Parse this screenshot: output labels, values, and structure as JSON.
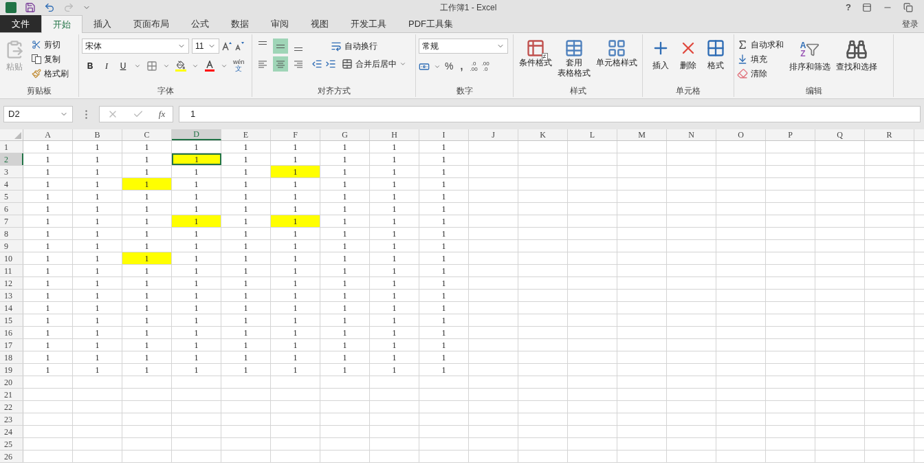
{
  "title_bar": {
    "title": "工作簿1 - Excel",
    "help": "?"
  },
  "ribbon_tabs": {
    "file": "文件",
    "tabs": [
      {
        "label": "开始",
        "selected": true
      },
      {
        "label": "插入",
        "selected": false
      },
      {
        "label": "页面布局",
        "selected": false
      },
      {
        "label": "公式",
        "selected": false
      },
      {
        "label": "数据",
        "selected": false
      },
      {
        "label": "审阅",
        "selected": false
      },
      {
        "label": "视图",
        "selected": false
      },
      {
        "label": "开发工具",
        "selected": false
      },
      {
        "label": "PDF工具集",
        "selected": false
      }
    ],
    "sign_in": "登录"
  },
  "ribbon": {
    "clipboard": {
      "label": "剪贴板",
      "paste": "粘贴",
      "cut": "剪切",
      "copy": "复制",
      "format_painter": "格式刷"
    },
    "font": {
      "label": "字体",
      "font_name": "宋体",
      "font_size": "11",
      "bold": "B",
      "italic": "I",
      "underline": "U",
      "phonetic_top": "wén",
      "phonetic_bottom": "文"
    },
    "alignment": {
      "label": "对齐方式",
      "wrap_text": "自动换行",
      "merge_center": "合并后居中",
      "vertical": [
        {
          "selected": false
        },
        {
          "selected": true
        },
        {
          "selected": false
        }
      ],
      "horizontal": [
        {
          "selected": false
        },
        {
          "selected": true
        },
        {
          "selected": false
        }
      ]
    },
    "number": {
      "label": "数字",
      "format": "常规",
      "percent": "%",
      "comma": ",",
      "decimals": [
        {
          "top": ".0",
          "bottom": ".00"
        },
        {
          "top": ".00",
          "bottom": ".0"
        }
      ]
    },
    "styles": {
      "label": "样式",
      "buttons": [
        {
          "kind": "conditional",
          "lines": [
            "条件格式"
          ],
          "symbol": "≠"
        },
        {
          "kind": "table",
          "lines": [
            "套用",
            "表格格式"
          ]
        },
        {
          "kind": "cell",
          "lines": [
            "单元格样式"
          ]
        }
      ]
    },
    "cells": {
      "label": "单元格",
      "buttons": [
        {
          "kind": "insert",
          "label": "插入"
        },
        {
          "kind": "delete",
          "label": "删除"
        },
        {
          "kind": "format",
          "label": "格式"
        }
      ]
    },
    "editing": {
      "label": "编辑",
      "autosum": "自动求和",
      "fill": "填充",
      "clear": "清除",
      "sort_filter": "排序和筛选",
      "sort_letters": [
        "A",
        "Z"
      ],
      "find_select": "查找和选择"
    }
  },
  "formula_bar": {
    "name_box": "D2",
    "fx": "fx",
    "value": "1"
  },
  "sheet": {
    "columns": [
      {
        "label": "A",
        "selected": false
      },
      {
        "label": "B",
        "selected": false
      },
      {
        "label": "C",
        "selected": false
      },
      {
        "label": "D",
        "selected": true
      },
      {
        "label": "E",
        "selected": false
      },
      {
        "label": "F",
        "selected": false
      },
      {
        "label": "G",
        "selected": false
      },
      {
        "label": "H",
        "selected": false
      },
      {
        "label": "I",
        "selected": false
      },
      {
        "label": "J",
        "selected": false
      },
      {
        "label": "K",
        "selected": false
      },
      {
        "label": "L",
        "selected": false
      },
      {
        "label": "M",
        "selected": false
      },
      {
        "label": "N",
        "selected": false
      },
      {
        "label": "O",
        "selected": false
      },
      {
        "label": "P",
        "selected": false
      },
      {
        "label": "Q",
        "selected": false
      },
      {
        "label": "R",
        "selected": false
      }
    ],
    "rows": [
      {
        "label": "1",
        "selected": false,
        "cells": [
          {
            "value": "1",
            "highlighted": false,
            "selected": false
          },
          {
            "value": "1",
            "highlighted": false,
            "selected": false
          },
          {
            "value": "1",
            "highlighted": false,
            "selected": false
          },
          {
            "value": "1",
            "highlighted": false,
            "selected": false
          },
          {
            "value": "1",
            "highlighted": false,
            "selected": false
          },
          {
            "value": "1",
            "highlighted": false,
            "selected": false
          },
          {
            "value": "1",
            "highlighted": false,
            "selected": false
          },
          {
            "value": "1",
            "highlighted": false,
            "selected": false
          },
          {
            "value": "1",
            "highlighted": false,
            "selected": false
          }
        ]
      },
      {
        "label": "2",
        "selected": true,
        "cells": [
          {
            "value": "1",
            "highlighted": false,
            "selected": false
          },
          {
            "value": "1",
            "highlighted": false,
            "selected": false
          },
          {
            "value": "1",
            "highlighted": false,
            "selected": false
          },
          {
            "value": "1",
            "highlighted": true,
            "selected": true
          },
          {
            "value": "1",
            "highlighted": false,
            "selected": false
          },
          {
            "value": "1",
            "highlighted": false,
            "selected": false
          },
          {
            "value": "1",
            "highlighted": false,
            "selected": false
          },
          {
            "value": "1",
            "highlighted": false,
            "selected": false
          },
          {
            "value": "1",
            "highlighted": false,
            "selected": false
          }
        ]
      },
      {
        "label": "3",
        "selected": false,
        "cells": [
          {
            "value": "1",
            "highlighted": false,
            "selected": false
          },
          {
            "value": "1",
            "highlighted": false,
            "selected": false
          },
          {
            "value": "1",
            "highlighted": false,
            "selected": false
          },
          {
            "value": "1",
            "highlighted": false,
            "selected": false
          },
          {
            "value": "1",
            "highlighted": false,
            "selected": false
          },
          {
            "value": "1",
            "highlighted": true,
            "selected": false
          },
          {
            "value": "1",
            "highlighted": false,
            "selected": false
          },
          {
            "value": "1",
            "highlighted": false,
            "selected": false
          },
          {
            "value": "1",
            "highlighted": false,
            "selected": false
          }
        ]
      },
      {
        "label": "4",
        "selected": false,
        "cells": [
          {
            "value": "1",
            "highlighted": false,
            "selected": false
          },
          {
            "value": "1",
            "highlighted": false,
            "selected": false
          },
          {
            "value": "1",
            "highlighted": true,
            "selected": false
          },
          {
            "value": "1",
            "highlighted": false,
            "selected": false
          },
          {
            "value": "1",
            "highlighted": false,
            "selected": false
          },
          {
            "value": "1",
            "highlighted": false,
            "selected": false
          },
          {
            "value": "1",
            "highlighted": false,
            "selected": false
          },
          {
            "value": "1",
            "highlighted": false,
            "selected": false
          },
          {
            "value": "1",
            "highlighted": false,
            "selected": false
          }
        ]
      },
      {
        "label": "5",
        "selected": false,
        "cells": [
          {
            "value": "1",
            "highlighted": false,
            "selected": false
          },
          {
            "value": "1",
            "highlighted": false,
            "selected": false
          },
          {
            "value": "1",
            "highlighted": false,
            "selected": false
          },
          {
            "value": "1",
            "highlighted": false,
            "selected": false
          },
          {
            "value": "1",
            "highlighted": false,
            "selected": false
          },
          {
            "value": "1",
            "highlighted": false,
            "selected": false
          },
          {
            "value": "1",
            "highlighted": false,
            "selected": false
          },
          {
            "value": "1",
            "highlighted": false,
            "selected": false
          },
          {
            "value": "1",
            "highlighted": false,
            "selected": false
          }
        ]
      },
      {
        "label": "6",
        "selected": false,
        "cells": [
          {
            "value": "1",
            "highlighted": false,
            "selected": false
          },
          {
            "value": "1",
            "highlighted": false,
            "selected": false
          },
          {
            "value": "1",
            "highlighted": false,
            "selected": false
          },
          {
            "value": "1",
            "highlighted": false,
            "selected": false
          },
          {
            "value": "1",
            "highlighted": false,
            "selected": false
          },
          {
            "value": "1",
            "highlighted": false,
            "selected": false
          },
          {
            "value": "1",
            "highlighted": false,
            "selected": false
          },
          {
            "value": "1",
            "highlighted": false,
            "selected": false
          },
          {
            "value": "1",
            "highlighted": false,
            "selected": false
          }
        ]
      },
      {
        "label": "7",
        "selected": false,
        "cells": [
          {
            "value": "1",
            "highlighted": false,
            "selected": false
          },
          {
            "value": "1",
            "highlighted": false,
            "selected": false
          },
          {
            "value": "1",
            "highlighted": false,
            "selected": false
          },
          {
            "value": "1",
            "highlighted": true,
            "selected": false
          },
          {
            "value": "1",
            "highlighted": false,
            "selected": false
          },
          {
            "value": "1",
            "highlighted": true,
            "selected": false
          },
          {
            "value": "1",
            "highlighted": false,
            "selected": false
          },
          {
            "value": "1",
            "highlighted": false,
            "selected": false
          },
          {
            "value": "1",
            "highlighted": false,
            "selected": false
          }
        ]
      },
      {
        "label": "8",
        "selected": false,
        "cells": [
          {
            "value": "1",
            "highlighted": false,
            "selected": false
          },
          {
            "value": "1",
            "highlighted": false,
            "selected": false
          },
          {
            "value": "1",
            "highlighted": false,
            "selected": false
          },
          {
            "value": "1",
            "highlighted": false,
            "selected": false
          },
          {
            "value": "1",
            "highlighted": false,
            "selected": false
          },
          {
            "value": "1",
            "highlighted": false,
            "selected": false
          },
          {
            "value": "1",
            "highlighted": false,
            "selected": false
          },
          {
            "value": "1",
            "highlighted": false,
            "selected": false
          },
          {
            "value": "1",
            "highlighted": false,
            "selected": false
          }
        ]
      },
      {
        "label": "9",
        "selected": false,
        "cells": [
          {
            "value": "1",
            "highlighted": false,
            "selected": false
          },
          {
            "value": "1",
            "highlighted": false,
            "selected": false
          },
          {
            "value": "1",
            "highlighted": false,
            "selected": false
          },
          {
            "value": "1",
            "highlighted": false,
            "selected": false
          },
          {
            "value": "1",
            "highlighted": false,
            "selected": false
          },
          {
            "value": "1",
            "highlighted": false,
            "selected": false
          },
          {
            "value": "1",
            "highlighted": false,
            "selected": false
          },
          {
            "value": "1",
            "highlighted": false,
            "selected": false
          },
          {
            "value": "1",
            "highlighted": false,
            "selected": false
          }
        ]
      },
      {
        "label": "10",
        "selected": false,
        "cells": [
          {
            "value": "1",
            "highlighted": false,
            "selected": false
          },
          {
            "value": "1",
            "highlighted": false,
            "selected": false
          },
          {
            "value": "1",
            "highlighted": true,
            "selected": false
          },
          {
            "value": "1",
            "highlighted": false,
            "selected": false
          },
          {
            "value": "1",
            "highlighted": false,
            "selected": false
          },
          {
            "value": "1",
            "highlighted": false,
            "selected": false
          },
          {
            "value": "1",
            "highlighted": false,
            "selected": false
          },
          {
            "value": "1",
            "highlighted": false,
            "selected": false
          },
          {
            "value": "1",
            "highlighted": false,
            "selected": false
          }
        ]
      },
      {
        "label": "11",
        "selected": false,
        "cells": [
          {
            "value": "1",
            "highlighted": false,
            "selected": false
          },
          {
            "value": "1",
            "highlighted": false,
            "selected": false
          },
          {
            "value": "1",
            "highlighted": false,
            "selected": false
          },
          {
            "value": "1",
            "highlighted": false,
            "selected": false
          },
          {
            "value": "1",
            "highlighted": false,
            "selected": false
          },
          {
            "value": "1",
            "highlighted": false,
            "selected": false
          },
          {
            "value": "1",
            "highlighted": false,
            "selected": false
          },
          {
            "value": "1",
            "highlighted": false,
            "selected": false
          },
          {
            "value": "1",
            "highlighted": false,
            "selected": false
          }
        ]
      },
      {
        "label": "12",
        "selected": false,
        "cells": [
          {
            "value": "1",
            "highlighted": false,
            "selected": false
          },
          {
            "value": "1",
            "highlighted": false,
            "selected": false
          },
          {
            "value": "1",
            "highlighted": false,
            "selected": false
          },
          {
            "value": "1",
            "highlighted": false,
            "selected": false
          },
          {
            "value": "1",
            "highlighted": false,
            "selected": false
          },
          {
            "value": "1",
            "highlighted": false,
            "selected": false
          },
          {
            "value": "1",
            "highlighted": false,
            "selected": false
          },
          {
            "value": "1",
            "highlighted": false,
            "selected": false
          },
          {
            "value": "1",
            "highlighted": false,
            "selected": false
          }
        ]
      },
      {
        "label": "13",
        "selected": false,
        "cells": [
          {
            "value": "1",
            "highlighted": false,
            "selected": false
          },
          {
            "value": "1",
            "highlighted": false,
            "selected": false
          },
          {
            "value": "1",
            "highlighted": false,
            "selected": false
          },
          {
            "value": "1",
            "highlighted": false,
            "selected": false
          },
          {
            "value": "1",
            "highlighted": false,
            "selected": false
          },
          {
            "value": "1",
            "highlighted": false,
            "selected": false
          },
          {
            "value": "1",
            "highlighted": false,
            "selected": false
          },
          {
            "value": "1",
            "highlighted": false,
            "selected": false
          },
          {
            "value": "1",
            "highlighted": false,
            "selected": false
          }
        ]
      },
      {
        "label": "14",
        "selected": false,
        "cells": [
          {
            "value": "1",
            "highlighted": false,
            "selected": false
          },
          {
            "value": "1",
            "highlighted": false,
            "selected": false
          },
          {
            "value": "1",
            "highlighted": false,
            "selected": false
          },
          {
            "value": "1",
            "highlighted": false,
            "selected": false
          },
          {
            "value": "1",
            "highlighted": false,
            "selected": false
          },
          {
            "value": "1",
            "highlighted": false,
            "selected": false
          },
          {
            "value": "1",
            "highlighted": false,
            "selected": false
          },
          {
            "value": "1",
            "highlighted": false,
            "selected": false
          },
          {
            "value": "1",
            "highlighted": false,
            "selected": false
          }
        ]
      },
      {
        "label": "15",
        "selected": false,
        "cells": [
          {
            "value": "1",
            "highlighted": false,
            "selected": false
          },
          {
            "value": "1",
            "highlighted": false,
            "selected": false
          },
          {
            "value": "1",
            "highlighted": false,
            "selected": false
          },
          {
            "value": "1",
            "highlighted": false,
            "selected": false
          },
          {
            "value": "1",
            "highlighted": false,
            "selected": false
          },
          {
            "value": "1",
            "highlighted": false,
            "selected": false
          },
          {
            "value": "1",
            "highlighted": false,
            "selected": false
          },
          {
            "value": "1",
            "highlighted": false,
            "selected": false
          },
          {
            "value": "1",
            "highlighted": false,
            "selected": false
          }
        ]
      },
      {
        "label": "16",
        "selected": false,
        "cells": [
          {
            "value": "1",
            "highlighted": false,
            "selected": false
          },
          {
            "value": "1",
            "highlighted": false,
            "selected": false
          },
          {
            "value": "1",
            "highlighted": false,
            "selected": false
          },
          {
            "value": "1",
            "highlighted": false,
            "selected": false
          },
          {
            "value": "1",
            "highlighted": false,
            "selected": false
          },
          {
            "value": "1",
            "highlighted": false,
            "selected": false
          },
          {
            "value": "1",
            "highlighted": false,
            "selected": false
          },
          {
            "value": "1",
            "highlighted": false,
            "selected": false
          },
          {
            "value": "1",
            "highlighted": false,
            "selected": false
          }
        ]
      },
      {
        "label": "17",
        "selected": false,
        "cells": [
          {
            "value": "1",
            "highlighted": false,
            "selected": false
          },
          {
            "value": "1",
            "highlighted": false,
            "selected": false
          },
          {
            "value": "1",
            "highlighted": false,
            "selected": false
          },
          {
            "value": "1",
            "highlighted": false,
            "selected": false
          },
          {
            "value": "1",
            "highlighted": false,
            "selected": false
          },
          {
            "value": "1",
            "highlighted": false,
            "selected": false
          },
          {
            "value": "1",
            "highlighted": false,
            "selected": false
          },
          {
            "value": "1",
            "highlighted": false,
            "selected": false
          },
          {
            "value": "1",
            "highlighted": false,
            "selected": false
          }
        ]
      },
      {
        "label": "18",
        "selected": false,
        "cells": [
          {
            "value": "1",
            "highlighted": false,
            "selected": false
          },
          {
            "value": "1",
            "highlighted": false,
            "selected": false
          },
          {
            "value": "1",
            "highlighted": false,
            "selected": false
          },
          {
            "value": "1",
            "highlighted": false,
            "selected": false
          },
          {
            "value": "1",
            "highlighted": false,
            "selected": false
          },
          {
            "value": "1",
            "highlighted": false,
            "selected": false
          },
          {
            "value": "1",
            "highlighted": false,
            "selected": false
          },
          {
            "value": "1",
            "highlighted": false,
            "selected": false
          },
          {
            "value": "1",
            "highlighted": false,
            "selected": false
          }
        ]
      },
      {
        "label": "19",
        "selected": false,
        "cells": [
          {
            "value": "1",
            "highlighted": false,
            "selected": false
          },
          {
            "value": "1",
            "highlighted": false,
            "selected": false
          },
          {
            "value": "1",
            "highlighted": false,
            "selected": false
          },
          {
            "value": "1",
            "highlighted": false,
            "selected": false
          },
          {
            "value": "1",
            "highlighted": false,
            "selected": false
          },
          {
            "value": "1",
            "highlighted": false,
            "selected": false
          },
          {
            "value": "1",
            "highlighted": false,
            "selected": false
          },
          {
            "value": "1",
            "highlighted": false,
            "selected": false
          },
          {
            "value": "1",
            "highlighted": false,
            "selected": false
          }
        ]
      },
      {
        "label": "20",
        "selected": false
      },
      {
        "label": "21",
        "selected": false
      },
      {
        "label": "22",
        "selected": false
      },
      {
        "label": "23",
        "selected": false
      },
      {
        "label": "24",
        "selected": false
      },
      {
        "label": "25",
        "selected": false
      },
      {
        "label": "26",
        "selected": false
      }
    ]
  }
}
